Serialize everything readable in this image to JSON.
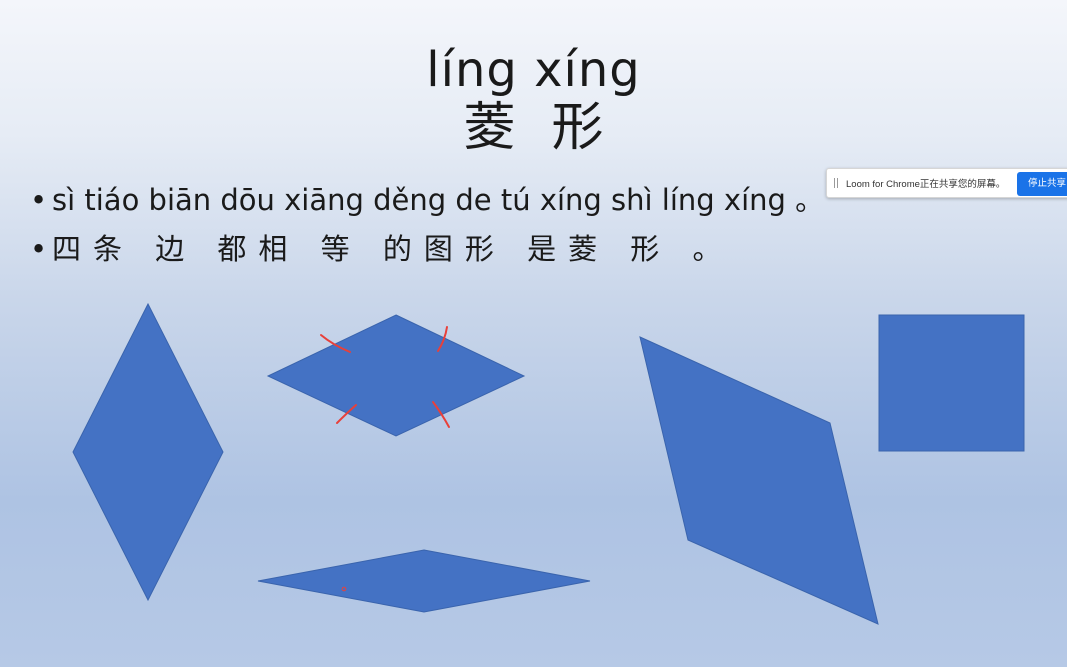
{
  "slide": {
    "title_pinyin": "líng xíng",
    "title_hanzi": "菱形",
    "bullets": [
      "sì tiáo biān dōu xiāng děng de tú xíng shì líng xíng 。",
      "四条 边 都相  等 的图形 是菱 形  。"
    ],
    "shape_color": "#4472c4",
    "mark_color": "#e8403a"
  },
  "loom": {
    "status_text": "Loom for Chrome正在共享您的屏幕。",
    "stop_label": "停止共享",
    "button_color": "#1a73e8"
  }
}
